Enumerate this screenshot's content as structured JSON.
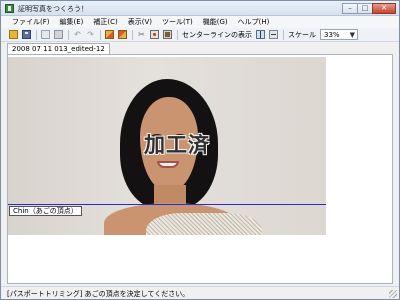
{
  "window": {
    "title": "証明写真をつくろう！"
  },
  "menu": [
    "ファイル(F)",
    "編集(E)",
    "補正(C)",
    "表示(V)",
    "ツール(T)",
    "機能(G)",
    "ヘルプ(H)"
  ],
  "toolbar": {
    "center_line_label": "センターラインの表示",
    "scale_label": "スケール",
    "scale_value": "33%"
  },
  "document_tab": "2008 07 11 013_edited-12",
  "canvas": {
    "watermark": "加工済",
    "chin_label": "Chin（あごの頂点）"
  },
  "status": {
    "text": "[パスポートトリミング] あごの頂点を決定してください。"
  }
}
